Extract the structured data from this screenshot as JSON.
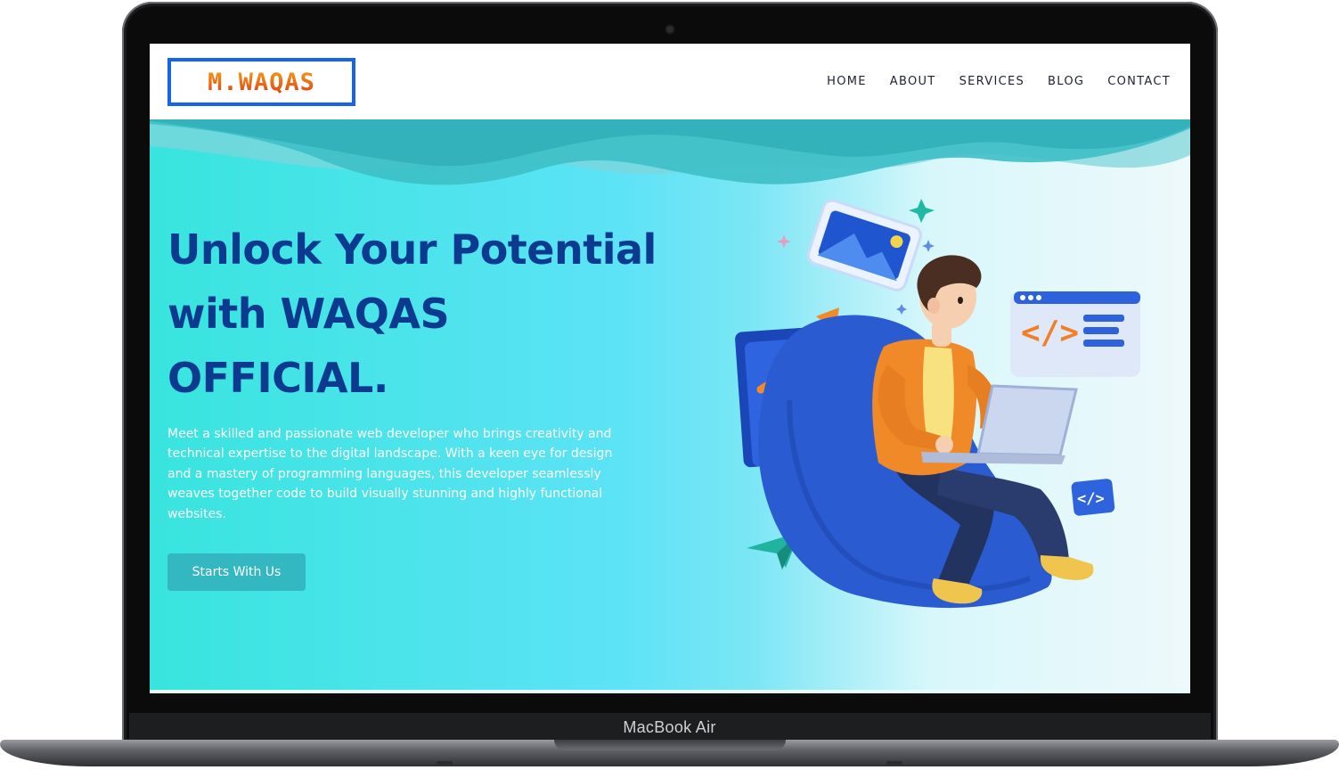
{
  "device": {
    "label": "MacBook Air"
  },
  "navbar": {
    "logo": "M.WAQAS",
    "links": [
      "HOME",
      "ABOUT",
      "SERVICES",
      "BLOG",
      "CONTACT"
    ]
  },
  "hero": {
    "headline_lines": [
      "Unlock Your Potential",
      "with WAQAS",
      "OFFICIAL."
    ],
    "description": "Meet a skilled and passionate web developer who brings creativity and technical expertise to the digital landscape. With a keen eye for design and a mastery of programming languages, this developer seamlessly weaves together code to build visually stunning and highly functional websites.",
    "cta_label": "Starts With Us"
  },
  "colors": {
    "logo_border": "#1565e8",
    "logo_text": "#ef7b12",
    "headline": "#0b3a8f",
    "cta_bg": "#33b7c0",
    "hero_left": "#38e4de",
    "hero_right": "#eef9fb"
  }
}
